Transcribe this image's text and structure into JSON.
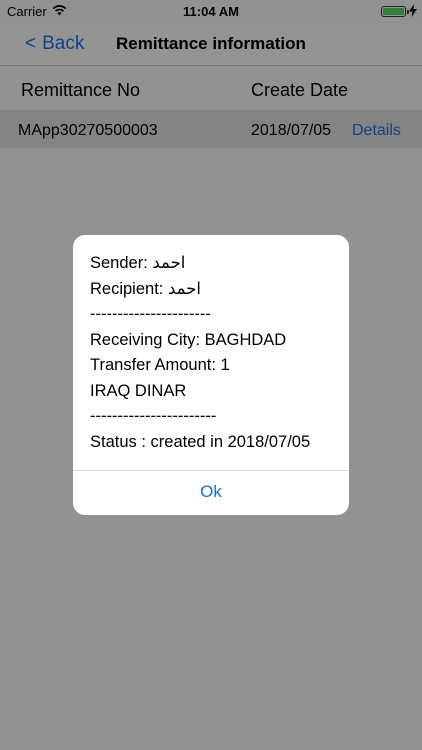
{
  "status_bar": {
    "carrier": "Carrier",
    "time": "11:04 AM",
    "battery_level": 1.0
  },
  "nav": {
    "back_label": "Back",
    "back_chevron": "<",
    "title": "Remittance information"
  },
  "table": {
    "headers": [
      "Remittance No",
      "Create Date"
    ],
    "rows": [
      {
        "no": "MApp30270500003",
        "date": "2018/07/05",
        "action": "Details"
      }
    ]
  },
  "alert": {
    "lines": [
      "Sender: احمد",
      "Recipient: احمد",
      "----------------------",
      "Receiving City: BAGHDAD",
      "Transfer Amount: 1",
      "IRAQ DINAR",
      "-----------------------",
      "Status : created in 2018/07/05"
    ],
    "ok_label": "Ok"
  },
  "colors": {
    "accent": "#1f6fe0",
    "battery": "#4cd964"
  }
}
